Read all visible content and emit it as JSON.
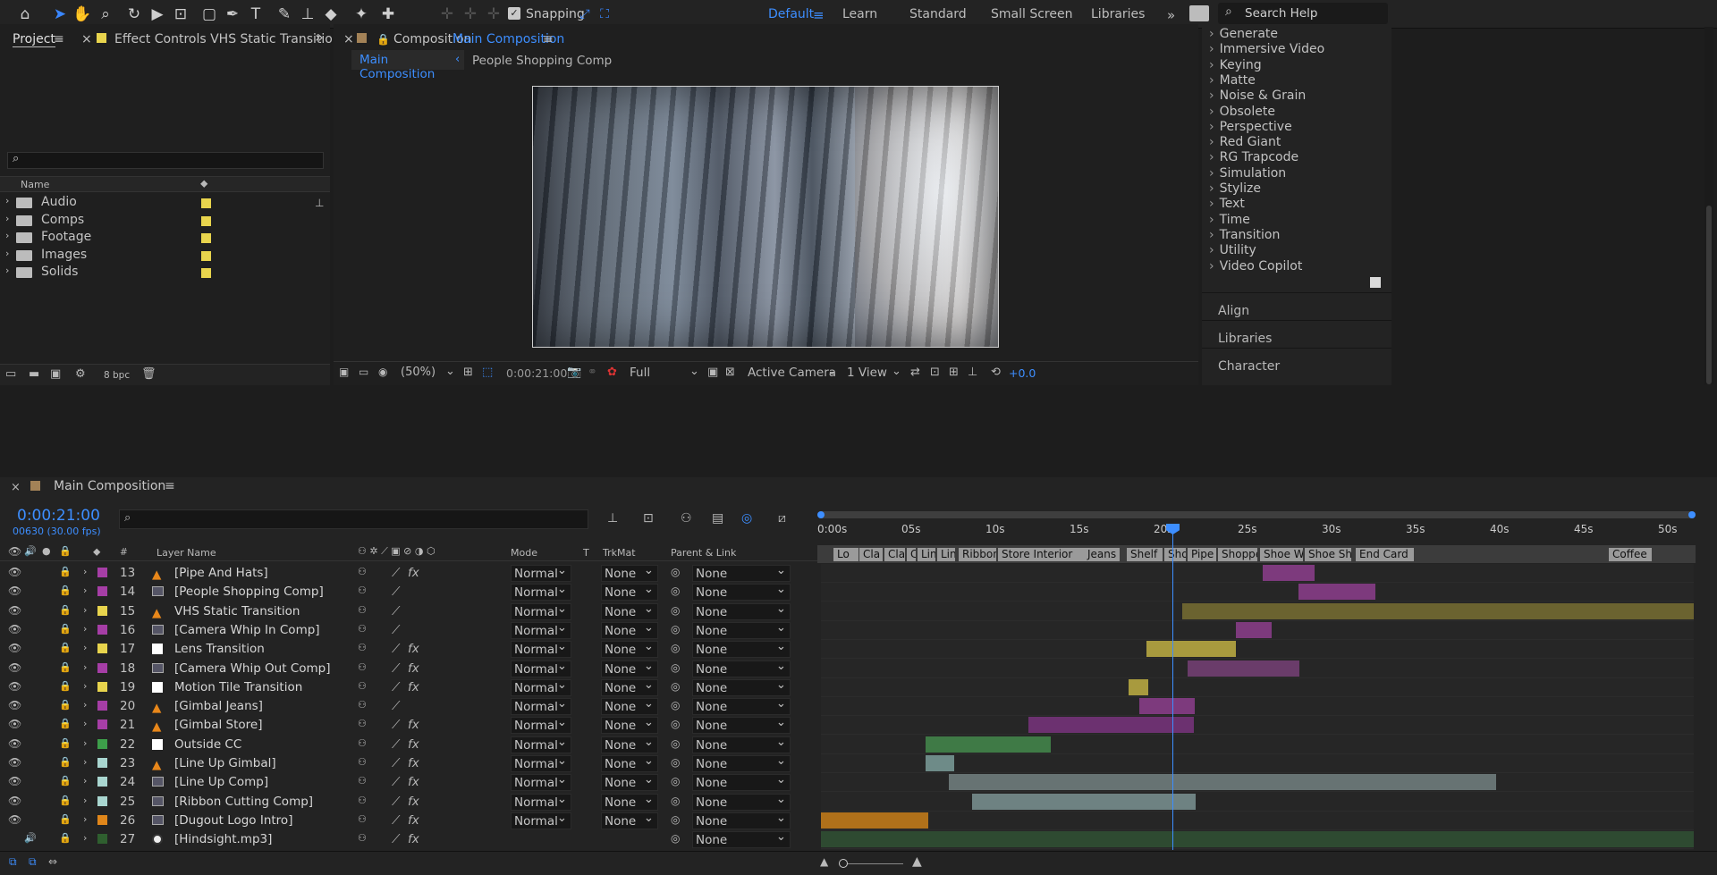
{
  "toolbar": {
    "snapping_label": "Snapping",
    "workspaces": [
      "Default",
      "Learn",
      "Standard",
      "Small Screen",
      "Libraries"
    ],
    "search_placeholder": "Search Help"
  },
  "project_panel": {
    "tab_project": "Project",
    "tab_effect_controls": "Effect Controls VHS Static Transition",
    "col_name": "Name",
    "items": [
      {
        "name": "Audio",
        "color": "#e8d44d"
      },
      {
        "name": "Comps",
        "color": "#e8d44d"
      },
      {
        "name": "Footage",
        "color": "#e8d44d"
      },
      {
        "name": "Images",
        "color": "#e8d44d"
      },
      {
        "name": "Solids",
        "color": "#e8d44d"
      }
    ],
    "bpc": "8 bpc"
  },
  "comp_panel": {
    "tab_prefix": "Composition",
    "tab_name": "Main Composition",
    "crumb_active": "Main Composition",
    "crumb_next": "People Shopping Comp",
    "zoom": "(50%)",
    "timecode": "0:00:21:00",
    "resolution": "Full",
    "camera": "Active Camera",
    "views": "1 View",
    "exposure": "+0.0"
  },
  "effects_panel": {
    "items": [
      "Generate",
      "Immersive Video",
      "Keying",
      "Matte",
      "Noise & Grain",
      "Obsolete",
      "Perspective",
      "Red Giant",
      "RG Trapcode",
      "Simulation",
      "Stylize",
      "Text",
      "Time",
      "Transition",
      "Utility",
      "Video Copilot"
    ],
    "sections": [
      "Align",
      "Libraries",
      "Character"
    ]
  },
  "timeline": {
    "comp_name": "Main Composition",
    "timecode": "0:00:21:00",
    "frames_fps": "00630 (30.00 fps)",
    "headers": {
      "num": "#",
      "layer_name": "Layer Name",
      "mode": "Mode",
      "t": "T",
      "trkmat": "TrkMat",
      "parent": "Parent & Link"
    },
    "ruler": [
      "0:00s",
      "05s",
      "10s",
      "15s",
      "20s",
      "25s",
      "30s",
      "35s",
      "40s",
      "45s",
      "50s"
    ],
    "markers": [
      "Lo",
      "Cla",
      "Cla",
      "C",
      "Lin",
      "Lin",
      "Ribbon",
      "Store Interior",
      "Jeans",
      "Shelf",
      "Sho",
      "Pipe",
      "Shoppe",
      "Shoe Wa",
      "Shoe She",
      "End Card",
      "Coffee"
    ],
    "layers": [
      {
        "num": "13",
        "name": "[Pipe And Hats]",
        "label": "#a63ea6",
        "icon": "cone",
        "fx": true,
        "mode": "Normal",
        "trkmat": "None",
        "parent": "None"
      },
      {
        "num": "14",
        "name": "[People Shopping Comp]",
        "label": "#a63ea6",
        "icon": "comp",
        "fx": false,
        "mode": "Normal",
        "trkmat": "None",
        "parent": "None"
      },
      {
        "num": "15",
        "name": "VHS Static Transition",
        "label": "#e8d44d",
        "icon": "cone",
        "fx": false,
        "mode": "Normal",
        "trkmat": "None",
        "parent": "None"
      },
      {
        "num": "16",
        "name": "[Camera Whip In Comp]",
        "label": "#a63ea6",
        "icon": "comp",
        "fx": false,
        "mode": "Normal",
        "trkmat": "None",
        "parent": "None"
      },
      {
        "num": "17",
        "name": "Lens Transition",
        "label": "#e8d44d",
        "icon": "solid",
        "fx": true,
        "mode": "Normal",
        "trkmat": "None",
        "parent": "None"
      },
      {
        "num": "18",
        "name": "[Camera Whip Out Comp]",
        "label": "#a63ea6",
        "icon": "comp",
        "fx": true,
        "mode": "Normal",
        "trkmat": "None",
        "parent": "None"
      },
      {
        "num": "19",
        "name": "Motion Tile Transition",
        "label": "#e8d44d",
        "icon": "solid",
        "fx": true,
        "mode": "Normal",
        "trkmat": "None",
        "parent": "None"
      },
      {
        "num": "20",
        "name": "[Gimbal Jeans]",
        "label": "#a63ea6",
        "icon": "cone",
        "fx": false,
        "mode": "Normal",
        "trkmat": "None",
        "parent": "None"
      },
      {
        "num": "21",
        "name": "[Gimbal Store]",
        "label": "#a63ea6",
        "icon": "cone",
        "fx": true,
        "mode": "Normal",
        "trkmat": "None",
        "parent": "None"
      },
      {
        "num": "22",
        "name": "Outside CC",
        "label": "#3d9e4a",
        "icon": "solid",
        "fx": true,
        "mode": "Normal",
        "trkmat": "None",
        "parent": "None"
      },
      {
        "num": "23",
        "name": "[Line Up Gimbal]",
        "label": "#a9d6d0",
        "icon": "cone",
        "fx": true,
        "mode": "Normal",
        "trkmat": "None",
        "parent": "None"
      },
      {
        "num": "24",
        "name": "[Line Up Comp]",
        "label": "#a9d6d0",
        "icon": "comp",
        "fx": true,
        "mode": "Normal",
        "trkmat": "None",
        "parent": "None"
      },
      {
        "num": "25",
        "name": "[Ribbon Cutting Comp]",
        "label": "#a9d6d0",
        "icon": "comp",
        "fx": true,
        "mode": "Normal",
        "trkmat": "None",
        "parent": "None"
      },
      {
        "num": "26",
        "name": "[Dugout Logo Intro]",
        "label": "#e0861a",
        "icon": "comp",
        "fx": true,
        "mode": "Normal",
        "trkmat": "None",
        "parent": "None"
      },
      {
        "num": "27",
        "name": "[Hindsight.mp3]",
        "label": "#2f5f2f",
        "icon": "audio",
        "fx": true,
        "mode": "",
        "trkmat": "",
        "parent": "None"
      }
    ]
  }
}
